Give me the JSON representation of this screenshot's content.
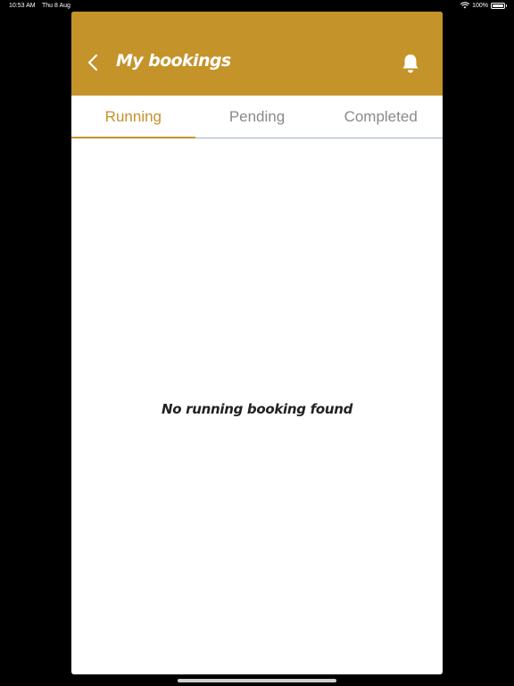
{
  "status_bar": {
    "time": "10:53 AM",
    "date": "Thu 8 Aug",
    "battery": "100%"
  },
  "header": {
    "title": "My bookings",
    "back_icon": "chevron-left-icon",
    "bell_icon": "bell-icon"
  },
  "tabs": [
    {
      "label": "Running",
      "active": true
    },
    {
      "label": "Pending",
      "active": false
    },
    {
      "label": "Completed",
      "active": false
    }
  ],
  "main": {
    "empty_message": "No running booking found"
  },
  "colors": {
    "accent": "#c4932a",
    "tab_inactive": "#8a8a8a",
    "background": "#ffffff"
  }
}
